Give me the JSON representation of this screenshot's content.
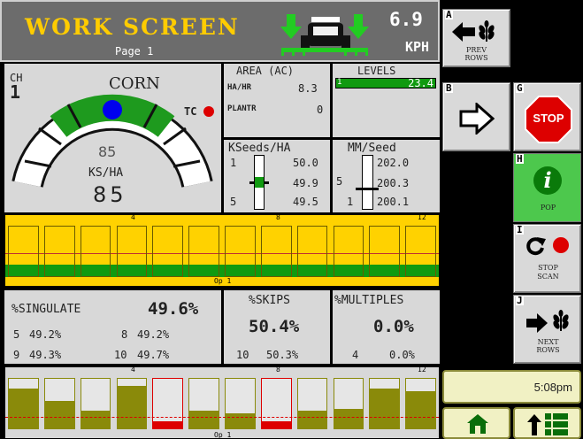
{
  "header": {
    "title": "WORK SCREEN",
    "page": "Page 1",
    "speed_value": "6.9",
    "speed_unit": "KPH"
  },
  "crop": {
    "channel_label": "CH",
    "channel_number": "1",
    "name": "CORN",
    "tc_label": "TC",
    "gauge_value": "85",
    "gauge_unit": "KS/HA",
    "population": "85"
  },
  "area": {
    "title": "AREA (AC)",
    "rate_label": "HA/HR",
    "rate_value": "8.3",
    "planter_label": "PLANTR",
    "planter_value": "0"
  },
  "levels": {
    "title": "LEVELS",
    "row": "1",
    "value": "23.4"
  },
  "kseeds": {
    "title": "KSeeds/HA",
    "row_top": "1",
    "row_bottom": "5",
    "v1": "50.0",
    "v2": "49.9",
    "v3": "49.5",
    "marker_level": 0.45
  },
  "mmseed": {
    "title": "MM/Seed",
    "row_top": "5",
    "row_bottom": "1",
    "v1": "202.0",
    "v2": "200.3",
    "v3": "200.1",
    "marker_level": 0.55
  },
  "row_bar1": {
    "ticks": [
      "4",
      "8",
      "12"
    ],
    "footer": "Op 1",
    "rows": 12
  },
  "singulate": {
    "title": "%SINGULATE",
    "value": "49.6%",
    "r1": "5",
    "v1": "49.2%",
    "r2": "8",
    "v2": "49.2%",
    "r3": "9",
    "v3": "49.3%",
    "r4": "10",
    "v4": "49.7%"
  },
  "skips": {
    "title": "%SKIPS",
    "value": "50.4%",
    "row": "10",
    "row_value": "50.3%"
  },
  "multiples": {
    "title": "%MULTIPLES",
    "value": "0.0%",
    "row": "4",
    "row_value": "0.0%"
  },
  "row_bar2": {
    "ticks": [
      "4",
      "8",
      "12"
    ],
    "footer": "Op 1",
    "levels": [
      0.8,
      0.55,
      0.35,
      0.85,
      0.0,
      0.35,
      0.3,
      0.0,
      0.35,
      0.4,
      0.8,
      0.75
    ],
    "flagged_rows": [
      5,
      8
    ]
  },
  "softkeys": {
    "a_letter": "A",
    "a_label": "PREV\nROWS",
    "b_letter": "B",
    "g_letter": "G",
    "g_label": "STOP",
    "h_letter": "H",
    "h_label": "POP",
    "i_letter": "I",
    "i_label": "STOP\nSCAN",
    "j_letter": "J",
    "j_label": "NEXT\nROWS"
  },
  "clock": "5:08pm",
  "colors": {
    "yellow": "#ffd200",
    "green": "#109a10",
    "olive": "#8a8a0a",
    "red": "#dd0000",
    "header_bg": "#6c6c6c",
    "title_yellow": "#ffcc00"
  }
}
